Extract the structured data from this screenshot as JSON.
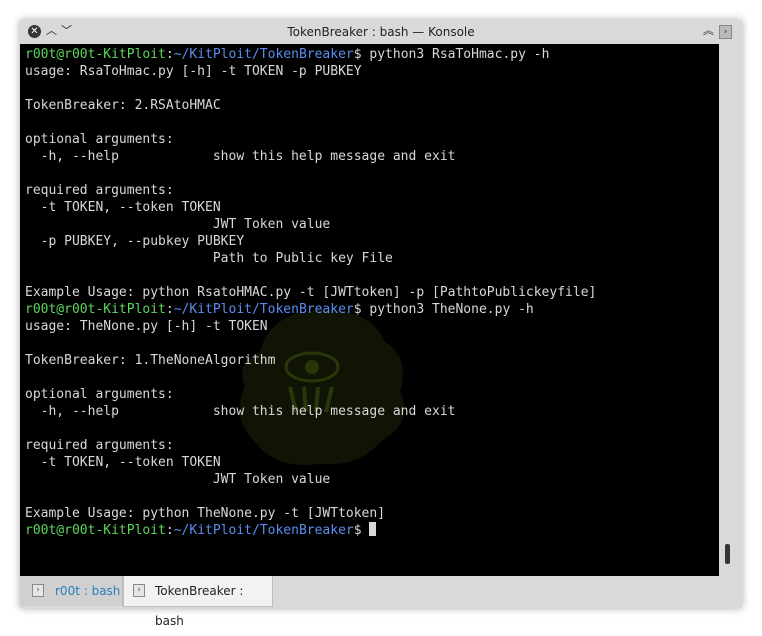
{
  "window": {
    "title": "TokenBreaker : bash — Konsole"
  },
  "prompt": {
    "user_host": "r00t@r00t-KitPloit",
    "sep": ":",
    "path": "~/KitPloit/TokenBreaker",
    "symbol": "$ "
  },
  "terminal": {
    "cmd1": "python3 RsaToHmac.py -h",
    "lines1": [
      "usage: RsaToHmac.py [-h] -t TOKEN -p PUBKEY",
      "",
      "TokenBreaker: 2.RSAtoHMAC",
      "",
      "optional arguments:",
      "  -h, --help            show this help message and exit",
      "",
      "required arguments:",
      "  -t TOKEN, --token TOKEN",
      "                        JWT Token value",
      "  -p PUBKEY, --pubkey PUBKEY",
      "                        Path to Public key File",
      "",
      "Example Usage: python RsatoHMAC.py -t [JWTtoken] -p [PathtoPublickeyfile]"
    ],
    "cmd2": "python3 TheNone.py -h",
    "lines2": [
      "usage: TheNone.py [-h] -t TOKEN",
      "",
      "TokenBreaker: 1.TheNoneAlgorithm",
      "",
      "optional arguments:",
      "  -h, --help            show this help message and exit",
      "",
      "required arguments:",
      "  -t TOKEN, --token TOKEN",
      "                        JWT Token value",
      "",
      "Example Usage: python TheNone.py -t [JWTtoken]"
    ]
  },
  "tabs": [
    {
      "label": "r00t : bash",
      "active": false
    },
    {
      "label": "TokenBreaker : bash",
      "active": true
    }
  ],
  "colors": {
    "user_host": "#5cd65c",
    "path": "#5a8df0",
    "text": "#d8d8d8",
    "background": "#000000"
  },
  "icons": {
    "close": "close-icon",
    "up": "chevron-up-icon",
    "down": "chevron-down-icon",
    "keep_above": "keep-above-icon",
    "terminal": "terminal-icon"
  }
}
